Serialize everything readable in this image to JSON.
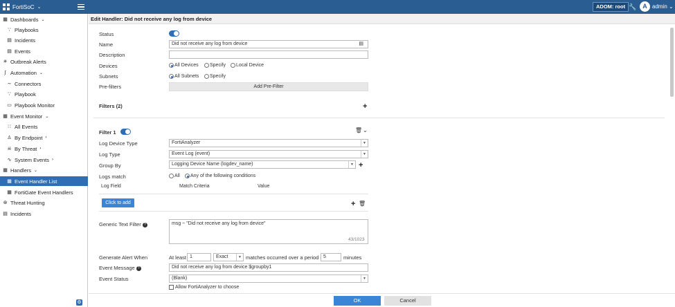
{
  "topbar": {
    "brand": "FortiSoC",
    "adom": "ADOM: root",
    "avatar_letter": "A",
    "user": "admin"
  },
  "sidebar": {
    "dashboards": "Dashboards",
    "playbooks": "Playbooks",
    "incidents": "Incidents",
    "events": "Events",
    "outbreak_alerts": "Outbreak Alerts",
    "automation": "Automation",
    "connectors": "Connectors",
    "playbook": "Playbook",
    "playbook_monitor": "Playbook Monitor",
    "event_monitor": "Event Monitor",
    "all_events": "All Events",
    "by_endpoint": "By Endpoint",
    "by_threat": "By Threat",
    "system_events": "System Events",
    "handlers": "Handlers",
    "event_handler_list": "Event Handler List",
    "fortigate_event_handlers": "FortiGate Event Handlers",
    "threat_hunting": "Threat Hunting",
    "incidents2": "Incidents"
  },
  "page": {
    "title": "Edit Handler: Did not receive any log from device"
  },
  "form": {
    "status_label": "Status",
    "name_label": "Name",
    "name_value": "Did not receive any log from device",
    "description_label": "Description",
    "devices_label": "Devices",
    "devices_opts": [
      "All Devices",
      "Specify",
      "Local Device"
    ],
    "subnets_label": "Subnets",
    "subnets_opts": [
      "All Subnets",
      "Specify"
    ],
    "prefilters_label": "Pre-filters",
    "add_prefilter": "Add Pre-Filter",
    "filters_heading": "Filters",
    "filters_count": "(2)",
    "filter1_label": "Filter 1",
    "log_device_type_label": "Log Device Type",
    "log_device_type_value": "FortiAnalyzer",
    "log_type_label": "Log Type",
    "log_type_value": "Event Log (event)",
    "group_by_label": "Group By",
    "group_by_value": "Logging Device Name (logdev_name)",
    "logs_match_label": "Logs match",
    "logs_match_opts": [
      "All",
      "Any of the following conditions"
    ],
    "col_log_field": "Log Field",
    "col_match_criteria": "Match Criteria",
    "col_value": "Value",
    "click_to_add": "Click to add",
    "generic_text_filter_label": "Generic Text Filter",
    "generic_text_filter_value": "msg ~ \"Did not receive any log from device\"",
    "char_counter": "43/1023",
    "generate_alert_label": "Generate Alert When",
    "at_least": "At least",
    "at_least_value": "1",
    "exact_value": "Exact",
    "matches_text": "matches occurred over a period of",
    "period_value": "5",
    "minutes": "minutes",
    "event_message_label": "Event Message",
    "event_message_value": "Did not receive any log from device $groupby1",
    "event_status_label": "Event Status",
    "event_status_value": "(Blank)",
    "allow_fa_label": "Allow FortiAnalyzer to choose"
  },
  "footer": {
    "ok": "OK",
    "cancel": "Cancel"
  },
  "colors": {
    "topbar": "#2a5d91",
    "accent": "#2f6eb5",
    "ok": "#3a85d6"
  }
}
